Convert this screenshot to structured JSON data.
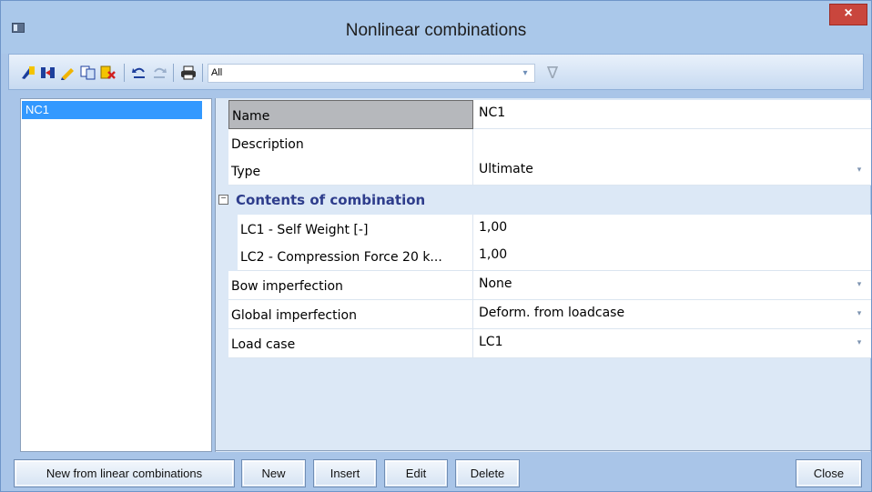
{
  "window": {
    "title": "Nonlinear combinations",
    "close_glyph": "×"
  },
  "toolbar": {
    "icons": [
      "new-item-icon",
      "insert-icon",
      "edit-icon",
      "copy-icon",
      "delete-icon",
      "undo-icon",
      "redo-icon",
      "print-icon"
    ],
    "filter_value": "All",
    "filter_arrow": "▾",
    "funnel_glyph": "∇"
  },
  "list": {
    "items": [
      "NC1"
    ]
  },
  "properties": {
    "name_label": "Name",
    "name_value": "NC1",
    "description_label": "Description",
    "description_value": "",
    "type_label": "Type",
    "type_value": "Ultimate",
    "section_label": "Contents of combination",
    "lc1_label": "LC1 - Self Weight [-]",
    "lc1_value": "1,00",
    "lc2_label": "LC2 - Compression Force 20 k...",
    "lc2_value": "1,00",
    "bow_label": "Bow imperfection",
    "bow_value": "None",
    "global_label": "Global imperfection",
    "global_value": "Deform. from loadcase",
    "loadcase_label": "Load case",
    "loadcase_value": "LC1",
    "dropdown_glyph": "▾",
    "collapse_glyph": "−"
  },
  "buttons": {
    "new_from_linear": "New from linear combinations",
    "new": "New",
    "insert": "Insert",
    "edit": "Edit",
    "delete": "Delete",
    "close": "Close"
  },
  "colors": {
    "selection": "#3399ff",
    "section_text": "#2e3d8c",
    "close_button": "#c9463d"
  }
}
